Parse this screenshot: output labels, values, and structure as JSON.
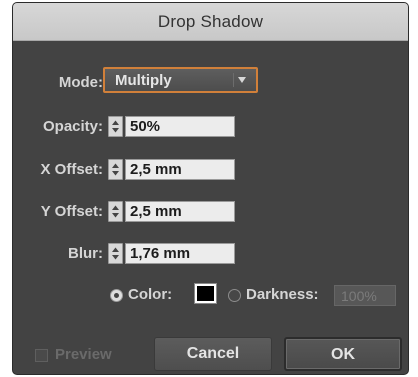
{
  "dialog": {
    "title": "Drop Shadow",
    "mode": {
      "label": "Mode:",
      "value": "Multiply"
    },
    "opacity": {
      "label": "Opacity:",
      "value": "50%"
    },
    "x_offset": {
      "label": "X Offset:",
      "value": "2,5 mm"
    },
    "y_offset": {
      "label": "Y Offset:",
      "value": "2,5 mm"
    },
    "blur": {
      "label": "Blur:",
      "value": "1,76 mm"
    },
    "color_option": {
      "label": "Color:",
      "selected": true,
      "swatch": "#000000"
    },
    "darkness_option": {
      "label": "Darkness:",
      "selected": false,
      "value": "100%"
    },
    "preview": {
      "label": "Preview",
      "checked": false
    },
    "buttons": {
      "cancel": "Cancel",
      "ok": "OK"
    }
  },
  "colors": {
    "dialog_bg": "#434343",
    "accent_focus": "#d1803a",
    "titlebar": "#c8c8c8"
  }
}
